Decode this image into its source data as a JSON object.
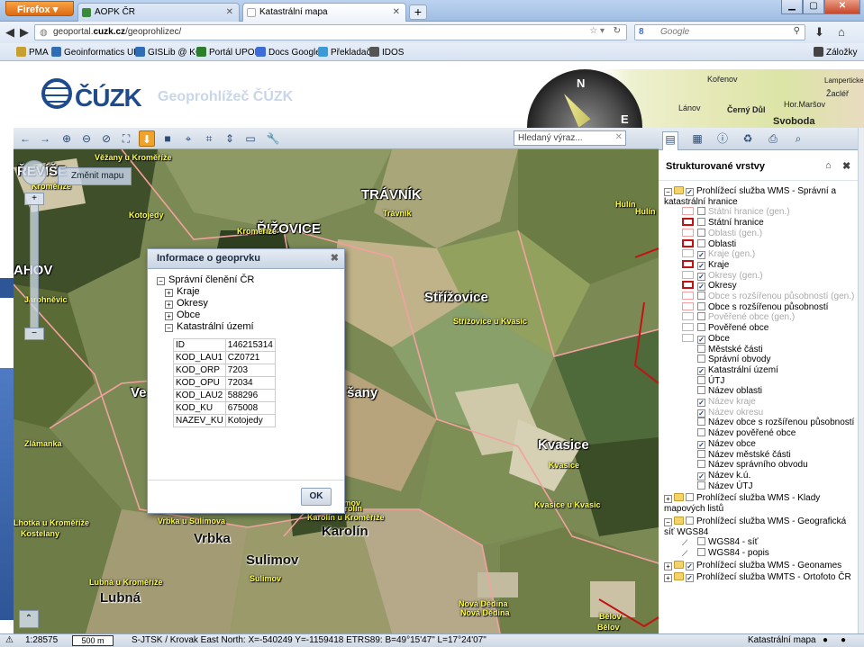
{
  "browser": {
    "firefox_label": "Firefox",
    "tabs": [
      {
        "title": "AOPK ČR",
        "active": false
      },
      {
        "title": "Katastrální mapa",
        "active": true
      }
    ],
    "new_tab_label": "+",
    "url_prefix": "geoportal.",
    "url_host": "cuzk.cz",
    "url_path": "/geoprohlizec/",
    "search_engine": "Google",
    "bookmarks": [
      "PMA",
      "Geoinformatics UP",
      "GISLib @ KGI",
      "Portál UPOL",
      "Docs Google",
      "Překladač",
      "IDOS"
    ],
    "bookmarks_folder": "Záložky"
  },
  "header": {
    "logo_text": "ČÚZK",
    "app_title": "Geoprohlížeč ČÚZK",
    "compass_letters": {
      "n": "N",
      "e": "E"
    },
    "map_labels": [
      "Lánov",
      "Černý Důl",
      "Hor.Maršov",
      "Svoboda",
      "Žacléř",
      "Lamperticke",
      "Kořenov"
    ]
  },
  "map_toolbar": {
    "search_placeholder": "Hledaný výraz..."
  },
  "map": {
    "change_map_label": "Změnit mapu",
    "labels_big": [
      {
        "text": "TRÁVNÍK"
      },
      {
        "text": "ŘIŽOVICE"
      },
      {
        "text": "Střížovice"
      },
      {
        "text": "Kvasice"
      },
      {
        "text": "Vrbka"
      },
      {
        "text": "Sulimov"
      },
      {
        "text": "Karolín"
      },
      {
        "text": "Lubná"
      },
      {
        "text": "ŘEVÍŠE"
      },
      {
        "text": "AHOV"
      },
      {
        "text": "Ve"
      },
      {
        "text": "šany"
      }
    ],
    "labels_small": [
      {
        "text": "Věžany u Kroměříže"
      },
      {
        "text": "Trávník"
      },
      {
        "text": "Kroměříže"
      },
      {
        "text": "Kotojedy"
      },
      {
        "text": "Kroměříže"
      },
      {
        "text": "Střížovice u Kvasic"
      },
      {
        "text": "Kvasice"
      },
      {
        "text": "Kvasice u Kvasic"
      },
      {
        "text": "Sulimov"
      },
      {
        "text": "Vrbka u Sulimova"
      },
      {
        "text": "Karolín u Kroměříže"
      },
      {
        "text": "Sulimov"
      },
      {
        "text": "Lubná u Kroměříže"
      },
      {
        "text": "Lhotka u Kroměříže"
      },
      {
        "text": "Kostelany"
      },
      {
        "text": "Nová Dědina"
      },
      {
        "text": "Nová Dědina"
      },
      {
        "text": "Bělov"
      },
      {
        "text": "Hulín"
      },
      {
        "text": "Zlámanka"
      },
      {
        "text": "Jarohněvic"
      },
      {
        "text": "Karolín"
      },
      {
        "text": "Bělov"
      },
      {
        "text": "Hulín"
      }
    ]
  },
  "dialog": {
    "title": "Informace o geoprvku",
    "root": "Správní členění ČR",
    "children": [
      "Kraje",
      "Okresy",
      "Obce",
      "Katastrální území"
    ],
    "attributes": [
      {
        "k": "ID",
        "v": "146215314"
      },
      {
        "k": "KOD_LAU1",
        "v": "CZ0721"
      },
      {
        "k": "KOD_ORP",
        "v": "7203"
      },
      {
        "k": "KOD_OPU",
        "v": "72034"
      },
      {
        "k": "KOD_LAU2",
        "v": "588296"
      },
      {
        "k": "KOD_KU",
        "v": "675008"
      },
      {
        "k": "NAZEV_KU",
        "v": "Kotojedy"
      }
    ],
    "ok_label": "OK"
  },
  "right_panel": {
    "title": "Strukturované vrstvy",
    "layers": [
      {
        "label": "Prohlížecí služba WMS - Správní a katastrální hranice",
        "type": "group",
        "checked": true,
        "expanded": true
      },
      {
        "label": "Státní hranice (gen.)",
        "dim": true,
        "sym": "pink",
        "checked": false
      },
      {
        "label": "Státní hranice",
        "sym": "red",
        "checked": false
      },
      {
        "label": "Oblasti (gen.)",
        "dim": true,
        "sym": "pink",
        "checked": false
      },
      {
        "label": "Oblasti",
        "sym": "red",
        "checked": false
      },
      {
        "label": "Kraje (gen.)",
        "dim": true,
        "sym": "pink",
        "checked": true
      },
      {
        "label": "Kraje",
        "sym": "red",
        "checked": true
      },
      {
        "label": "Okresy (gen.)",
        "dim": true,
        "sym": "pink",
        "checked": true
      },
      {
        "label": "Okresy",
        "sym": "red",
        "checked": true
      },
      {
        "label": "Obce s rozšířenou působností (gen.)",
        "dim": true,
        "sym": "pink",
        "checked": false
      },
      {
        "label": "Obce s rozšířenou působností",
        "sym": "pink",
        "checked": false
      },
      {
        "label": "Pověřené obce (gen.)",
        "dim": true,
        "sym": "pink",
        "checked": false
      },
      {
        "label": "Pověřené obce",
        "sym": "pink",
        "checked": false
      },
      {
        "label": "Obce",
        "sym": "pink",
        "checked": true
      },
      {
        "label": "Městské části",
        "sym": "none",
        "checked": false
      },
      {
        "label": "Správní obvody",
        "sym": "none",
        "checked": false
      },
      {
        "label": "Katastrální území",
        "sym": "none",
        "checked": true
      },
      {
        "label": "ÚTJ",
        "sym": "none",
        "checked": false
      },
      {
        "label": "Název oblasti",
        "sym": "none",
        "checked": false
      },
      {
        "label": "Název kraje",
        "dim": true,
        "sym": "none",
        "checked": true
      },
      {
        "label": "Název okresu",
        "dim": true,
        "sym": "none",
        "checked": true
      },
      {
        "label": "Název obce s rozšířenou působností",
        "sym": "none",
        "checked": false
      },
      {
        "label": "Název pověřené obce",
        "sym": "none",
        "checked": false
      },
      {
        "label": "Název obce",
        "sym": "none",
        "checked": true
      },
      {
        "label": "Název městské části",
        "sym": "none",
        "checked": false
      },
      {
        "label": "Název správního obvodu",
        "sym": "none",
        "checked": false
      },
      {
        "label": "Název k.ú.",
        "sym": "none",
        "checked": true
      },
      {
        "label": "Název ÚTJ",
        "sym": "none",
        "checked": false
      },
      {
        "label": "Prohlížecí služba WMS - Klady mapových listů",
        "type": "group",
        "checked": false,
        "expanded": false
      },
      {
        "label": "Prohlížecí služba WMS - Geografická síť WGS84",
        "type": "group",
        "checked": false,
        "expanded": true
      },
      {
        "label": "WGS84 - síť",
        "sym": "wgs",
        "checked": false
      },
      {
        "label": "WGS84 - popis",
        "sym": "wgs",
        "checked": false
      },
      {
        "label": "Prohlížecí služba WMS - Geonames",
        "type": "group",
        "checked": true,
        "expanded": false
      },
      {
        "label": "Prohlížecí služba WMTS - Ortofoto ČR",
        "type": "group",
        "checked": true,
        "expanded": false
      }
    ]
  },
  "status": {
    "scale": "1:28575",
    "scalebar": "500 m",
    "coords": "S-JTSK / Krovak East North: X=-540249 Y=-1159418  ETRS89: B=49°15'47\" L=17°24'07\"",
    "map_name": "Katastrální mapa"
  },
  "colors": {
    "accent_orange": "#f0a32a",
    "boundary_red": "#c41212",
    "boundary_pink": "#f4a0a0",
    "logo_blue": "#1e4b8c"
  }
}
